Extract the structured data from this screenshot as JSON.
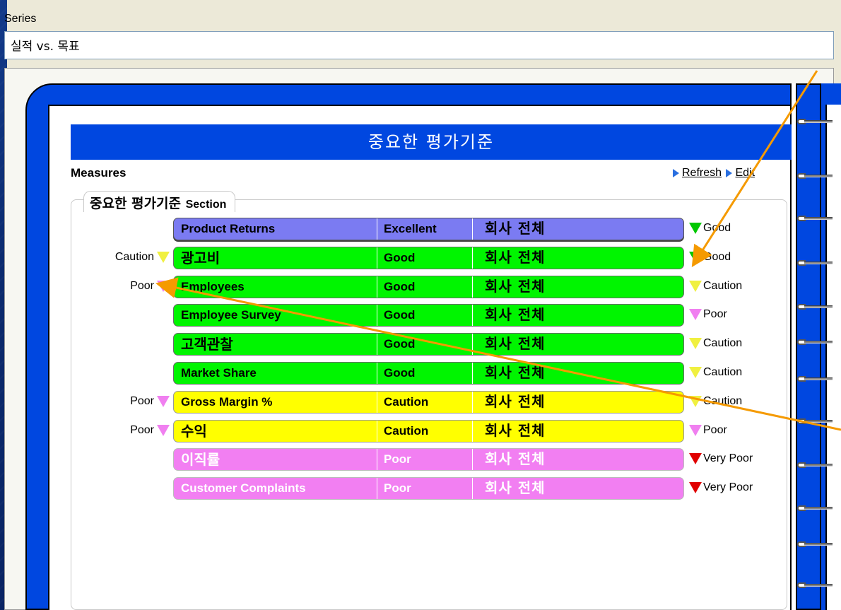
{
  "colors": {
    "binder_blue": "#0047e0",
    "excellent": "#7b7bf2",
    "good": "#00f500",
    "caution": "#ffff00",
    "poor": "#f27ff2",
    "very_poor_indicator": "#e00000",
    "good_indicator": "#00c800",
    "caution_indicator": "#f0f040",
    "poor_indicator": "#f07ff0",
    "annotation_arrow": "#f59a00"
  },
  "series": {
    "label": "Series",
    "value": "실적 vs. 목표"
  },
  "scorecard": {
    "title": "중요한 평가기준",
    "measures_label": "Measures",
    "refresh_label": "Refresh",
    "edit_label": "Edit",
    "section_title_kr": "중요한 평가기준",
    "section_title_en": "Section"
  },
  "rows": [
    {
      "name": "Product Returns",
      "status": "Excellent",
      "scope": "회사 전체",
      "trend": "Good",
      "trend_color": "green",
      "prev": "",
      "prev_color": "",
      "row_color": "purple",
      "korean": false
    },
    {
      "name": "광고비",
      "status": "Good",
      "scope": "회사 전체",
      "trend": "Good",
      "trend_color": "green",
      "prev": "Caution",
      "prev_color": "yellow",
      "row_color": "green",
      "korean": true
    },
    {
      "name": "Employees",
      "status": "Good",
      "scope": "회사 전체",
      "trend": "Caution",
      "trend_color": "yellow",
      "prev": "Poor",
      "prev_color": "pink",
      "row_color": "green",
      "korean": false
    },
    {
      "name": "Employee Survey",
      "status": "Good",
      "scope": "회사 전체",
      "trend": "Poor",
      "trend_color": "pink",
      "prev": "",
      "prev_color": "",
      "row_color": "green",
      "korean": false
    },
    {
      "name": "고객관찰",
      "status": "Good",
      "scope": "회사 전체",
      "trend": "Caution",
      "trend_color": "yellow",
      "prev": "",
      "prev_color": "",
      "row_color": "green",
      "korean": true
    },
    {
      "name": "Market Share",
      "status": "Good",
      "scope": "회사 전체",
      "trend": "Caution",
      "trend_color": "yellow",
      "prev": "",
      "prev_color": "",
      "row_color": "green",
      "korean": false
    },
    {
      "name": "Gross Margin %",
      "status": "Caution",
      "scope": "회사 전체",
      "trend": "Caution",
      "trend_color": "yellow",
      "prev": "Poor",
      "prev_color": "pink",
      "row_color": "yellow",
      "korean": false
    },
    {
      "name": "수익",
      "status": "Caution",
      "scope": "회사 전체",
      "trend": "Poor",
      "trend_color": "pink",
      "prev": "Poor",
      "prev_color": "pink",
      "row_color": "yellow",
      "korean": true
    },
    {
      "name": "이직률",
      "status": "Poor",
      "scope": "회사 전체",
      "trend": "Very Poor",
      "trend_color": "red",
      "prev": "",
      "prev_color": "",
      "row_color": "pink",
      "korean": true
    },
    {
      "name": "Customer Complaints",
      "status": "Poor",
      "scope": "회사 전체",
      "trend": "Very Poor",
      "trend_color": "red",
      "prev": "",
      "prev_color": "",
      "row_color": "pink",
      "korean": false
    }
  ]
}
